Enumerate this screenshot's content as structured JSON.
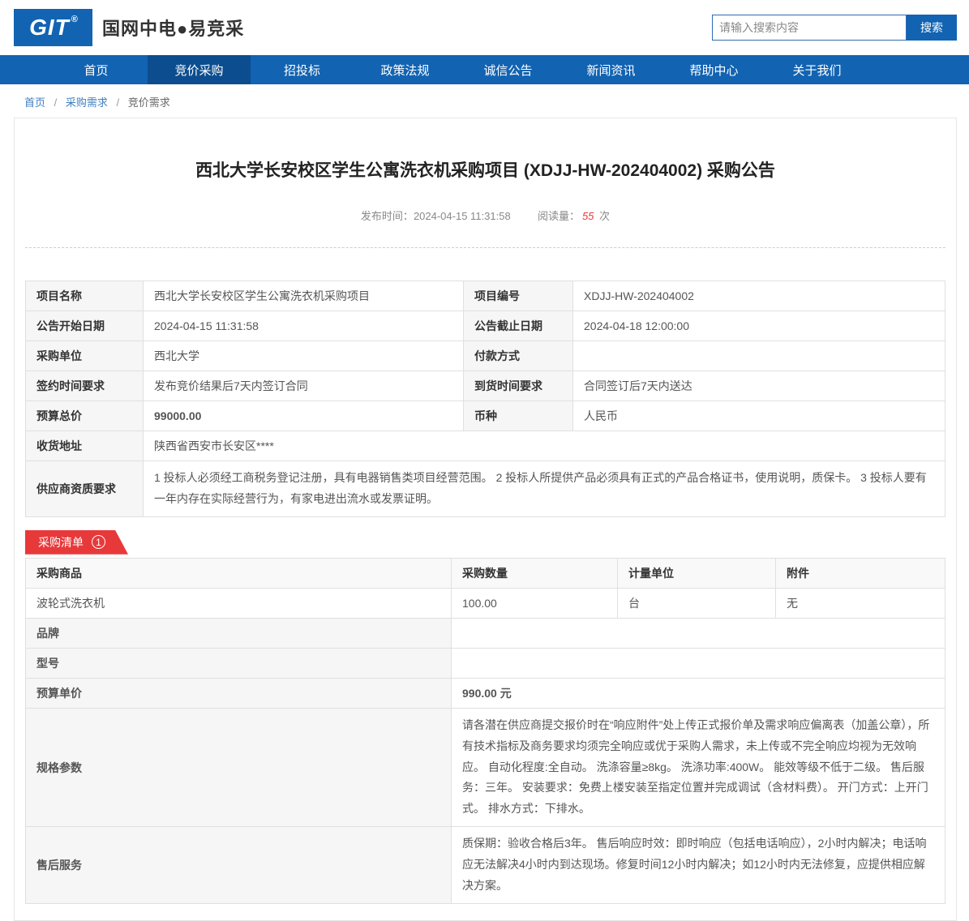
{
  "header": {
    "logo_text": "GIT",
    "logo_reg": "®",
    "brand": "国网中电●易竞采",
    "search": {
      "placeholder": "请输入搜索内容",
      "button_label": "搜索"
    }
  },
  "nav": {
    "items": [
      {
        "label": "首页"
      },
      {
        "label": "竞价采购",
        "active": true
      },
      {
        "label": "招投标"
      },
      {
        "label": "政策法规"
      },
      {
        "label": "诚信公告"
      },
      {
        "label": "新闻资讯"
      },
      {
        "label": "帮助中心"
      },
      {
        "label": "关于我们"
      }
    ]
  },
  "breadcrumb": {
    "separator": "/",
    "items": [
      "首页",
      "采购需求",
      "竞价需求"
    ]
  },
  "announcement": {
    "title": "西北大学长安校区学生公寓洗衣机采购项目 (XDJJ-HW-202404002) 采购公告",
    "publish_label": "发布时间：",
    "publish_time": "2024-04-15 11:31:58",
    "views_label": "阅读量：",
    "views": "55",
    "views_unit": "次"
  },
  "details": {
    "rows": [
      {
        "label1": "项目名称",
        "value1": "西北大学长安校区学生公寓洗衣机采购项目",
        "label2": "项目编号",
        "value2": "XDJJ-HW-202404002"
      },
      {
        "label1": "公告开始日期",
        "value1": "2024-04-15 11:31:58",
        "label2": "公告截止日期",
        "value2": "2024-04-18 12:00:00"
      },
      {
        "label1": "采购单位",
        "value1": "西北大学",
        "label2": "付款方式",
        "value2": ""
      },
      {
        "label1": "签约时间要求",
        "value1": "发布竞价结果后7天内签订合同",
        "label2": "到货时间要求",
        "value2": "合同签订后7天内送达"
      },
      {
        "label1": "预算总价",
        "value1": "99000.00",
        "label2": "币种",
        "value2": "人民币"
      }
    ],
    "address_label": "收货地址",
    "address_value": "陕西省西安市长安区****",
    "qualification_label": "供应商资质要求",
    "qualification_value": "1 投标人必须经工商税务登记注册，具有电器销售类项目经营范围。 2 投标人所提供产品必须具有正式的产品合格证书，使用说明，质保卡。 3 投标人要有一年内存在实际经营行为，有家电进出流水或发票证明。"
  },
  "purchase_list": {
    "badge_label": "采购清单",
    "badge_count": "1",
    "columns": [
      "采购商品",
      "采购数量",
      "计量单位",
      "附件"
    ],
    "item": {
      "product": "波轮式洗衣机",
      "quantity": "100.00",
      "unit": "台",
      "attachment": "无"
    },
    "fields": {
      "brand_label": "品牌",
      "brand_value": "",
      "model_label": "型号",
      "model_value": "",
      "unit_price_label": "预算单价",
      "unit_price_value": "990.00 元",
      "spec_label": "规格参数",
      "spec_value": "请各潜在供应商提交报价时在“响应附件”处上传正式报价单及需求响应偏离表（加盖公章），所有技术指标及商务要求均须完全响应或优于采购人需求，未上传或不完全响应均视为无效响应。 自动化程度:全自动。 洗涤容量≥8kg。 洗涤功率:400W。 能效等级不低于二级。 售后服务：三年。 安装要求：免费上楼安装至指定位置并完成调试（含材料费）。 开门方式：上开门式。 排水方式：下排水。",
      "service_label": "售后服务",
      "service_value": "质保期：验收合格后3年。 售后响应时效：即时响应（包括电话响应），2小时内解决；电话响应无法解决4小时内到达现场。修复时间12小时内解决；如12小时内无法修复，应提供相应解决方案。"
    }
  },
  "colors": {
    "nav_blue": "#1263b2",
    "nav_active_blue": "#0c4d8f",
    "accent_red": "#e8393a",
    "link_blue": "#3e7fc1"
  }
}
